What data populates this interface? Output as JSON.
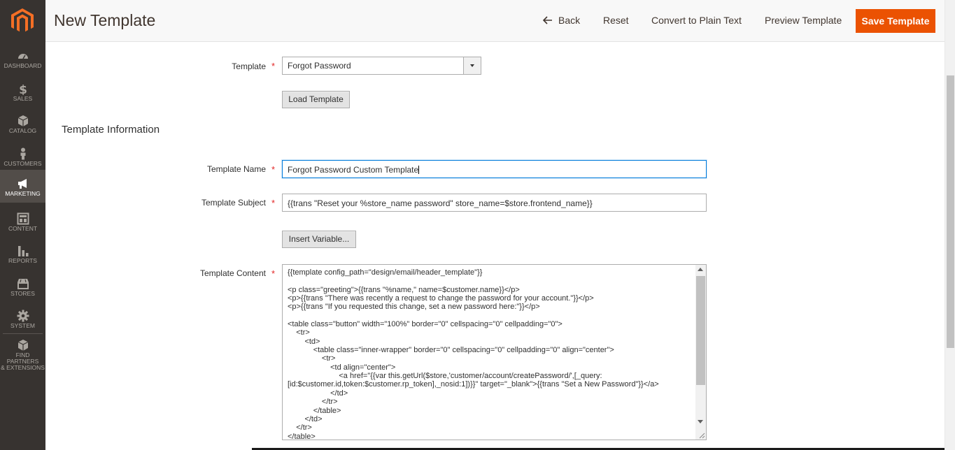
{
  "sidebar": {
    "items": [
      {
        "label": "DASHBOARD",
        "icon": "dashboard-icon"
      },
      {
        "label": "SALES",
        "icon": "dollar-icon"
      },
      {
        "label": "CATALOG",
        "icon": "box-icon"
      },
      {
        "label": "CUSTOMERS",
        "icon": "person-icon"
      },
      {
        "label": "MARKETING",
        "icon": "megaphone-icon",
        "active": true
      },
      {
        "label": "CONTENT",
        "icon": "layout-icon"
      },
      {
        "label": "REPORTS",
        "icon": "bar-chart-icon"
      },
      {
        "label": "STORES",
        "icon": "store-icon"
      },
      {
        "label": "SYSTEM",
        "icon": "gear-icon"
      },
      {
        "label_line1": "FIND PARTNERS",
        "label_line2": "& EXTENSIONS",
        "icon": "cube-icon"
      }
    ]
  },
  "header": {
    "title": "New Template",
    "back_label": "Back",
    "reset_label": "Reset",
    "plain_text_label": "Convert to Plain Text",
    "preview_label": "Preview Template",
    "save_label": "Save Template"
  },
  "form": {
    "template_label": "Template",
    "template_value": "Forgot Password",
    "load_button": "Load Template",
    "section_title": "Template Information",
    "name_label": "Template Name",
    "name_value": "Forgot Password Custom Template",
    "subject_label": "Template Subject",
    "subject_value": "{{trans \"Reset your %store_name password\" store_name=$store.frontend_name}}",
    "insert_variable_button": "Insert Variable...",
    "content_label": "Template Content",
    "content_value": "{{template config_path=\"design/email/header_template\"}}\n\n<p class=\"greeting\">{{trans \"%name,\" name=$customer.name}}</p>\n<p>{{trans \"There was recently a request to change the password for your account.\"}}</p>\n<p>{{trans \"If you requested this change, set a new password here:\"}}</p>\n\n<table class=\"button\" width=\"100%\" border=\"0\" cellspacing=\"0\" cellpadding=\"0\">\n    <tr>\n        <td>\n            <table class=\"inner-wrapper\" border=\"0\" cellspacing=\"0\" cellpadding=\"0\" align=\"center\">\n                <tr>\n                    <td align=\"center\">\n                        <a href=\"{{var this.getUrl($store,'customer/account/createPassword/',[_query:[id:$customer.id,token:$customer.rp_token],_nosid:1])}}\" target=\"_blank\">{{trans \"Set a New Password\"}}</a>\n                    </td>\n                </tr>\n            </table>\n        </td>\n    </tr>\n</table>",
    "required_mark": "*"
  },
  "colors": {
    "sidebar_bg": "#373330",
    "accent": "#eb5202",
    "focus": "#007bdb"
  }
}
